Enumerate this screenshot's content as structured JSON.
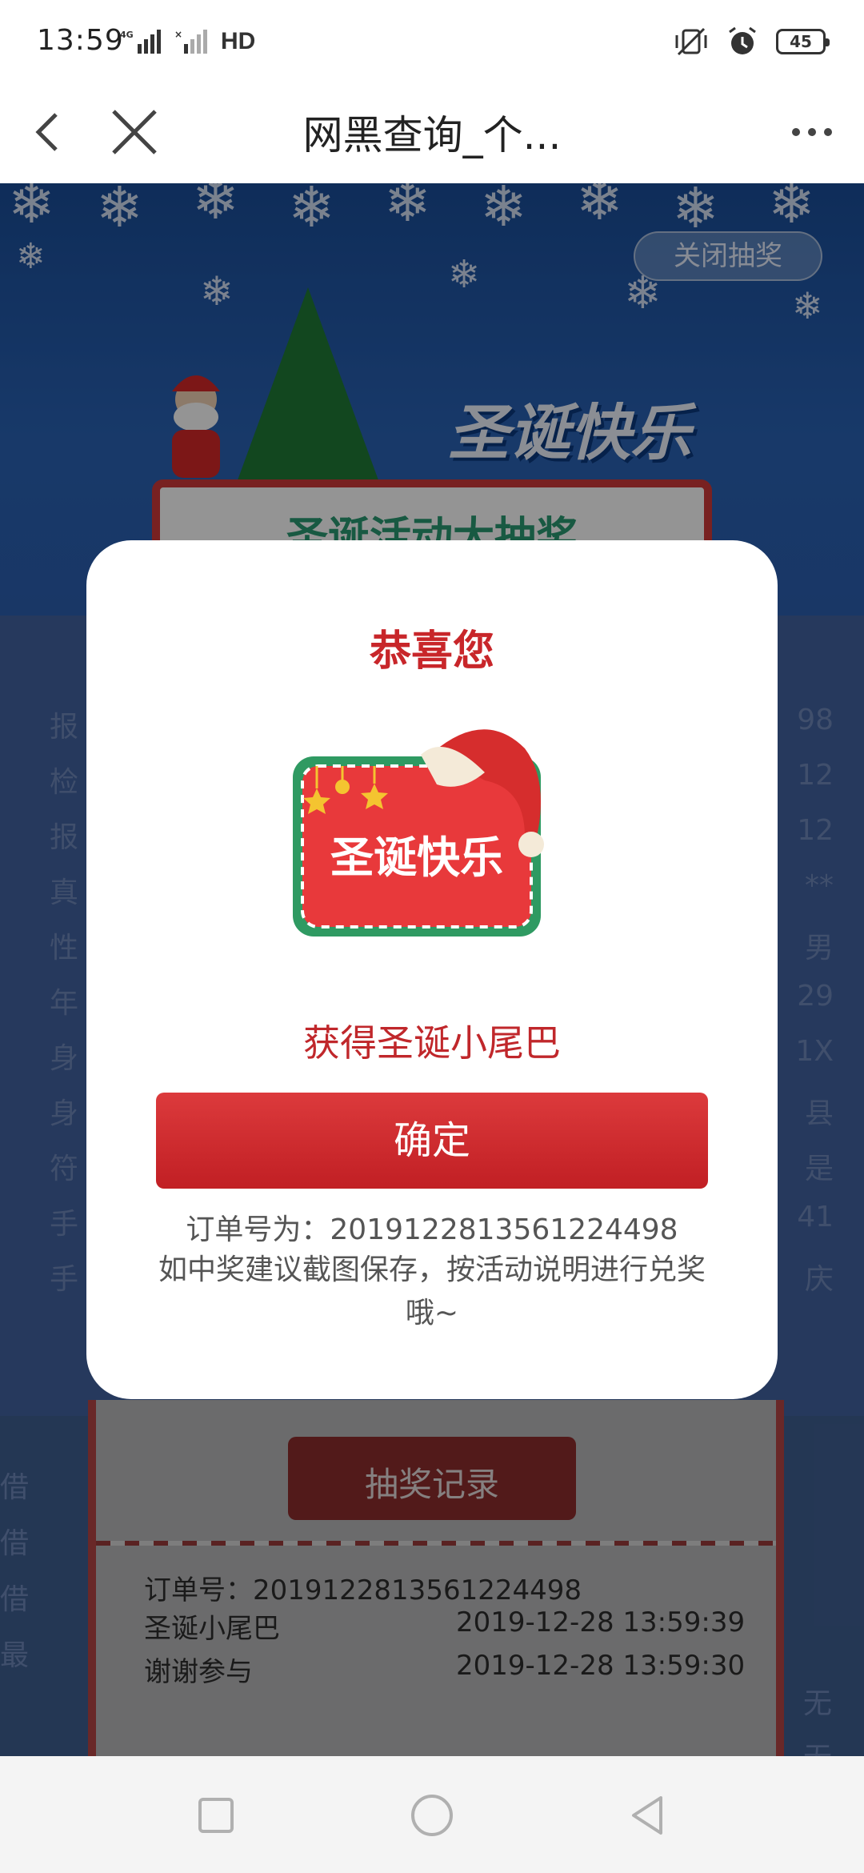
{
  "status_bar": {
    "time": "13:59",
    "network": "HD",
    "battery": "45"
  },
  "nav": {
    "title": "网黑查询_个..."
  },
  "banner": {
    "close_lottery": "关闭抽奖",
    "title": "圣诞快乐",
    "lottery_heading": "圣诞活动大抽奖"
  },
  "background_info": {
    "left_labels": [
      "报",
      "检",
      "报",
      "真",
      "性",
      "年",
      "身",
      "身",
      "符",
      "手",
      "手"
    ],
    "right_values": [
      "98",
      "12",
      "12",
      "**",
      "男",
      "29",
      "1X",
      "县",
      "是",
      "41",
      "庆"
    ]
  },
  "records": {
    "heading": "抽奖记录",
    "order_label": "订单号：2019122813561224498",
    "rows": [
      {
        "name": "圣诞小尾巴",
        "time": "2019-12-28 13:59:39"
      },
      {
        "name": "谢谢参与",
        "time": "2019-12-28 13:59:30"
      }
    ],
    "side_left": [
      "借",
      "借",
      "借",
      "最"
    ],
    "side_right": [
      "无",
      "无"
    ]
  },
  "modal": {
    "title": "恭喜您",
    "badge_text": "圣诞快乐",
    "prize": "获得圣诞小尾巴",
    "confirm": "确定",
    "order": "订单号为：2019122813561224498",
    "tip": "如中奖建议截图保存，按活动说明进行兑奖哦~"
  },
  "colors": {
    "accent_red": "#c8262a",
    "banner_blue": "#2a63b6",
    "button_red": "#d12c30"
  }
}
